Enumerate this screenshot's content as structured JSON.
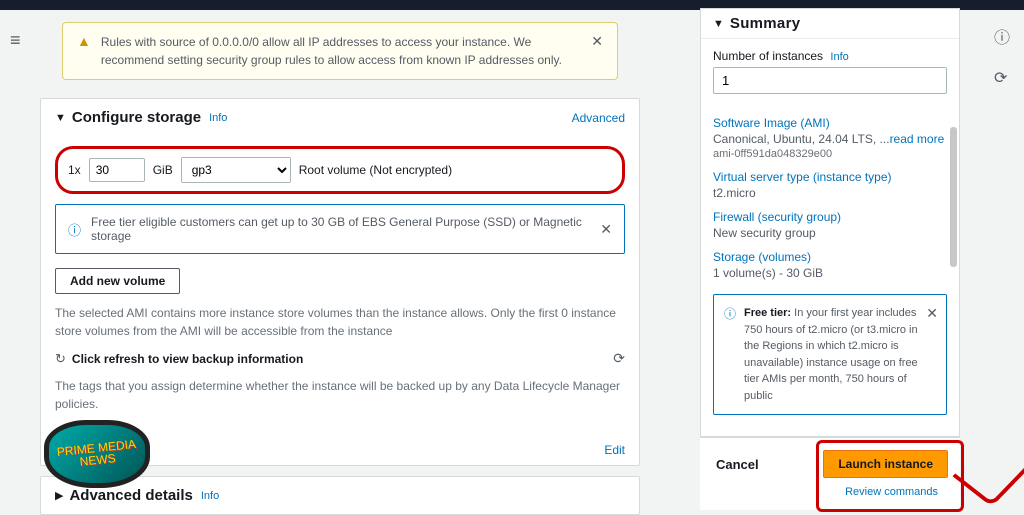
{
  "warning": {
    "text": "Rules with source of 0.0.0.0/0 allow all IP addresses to access your instance. We recommend setting security group rules to allow access from known IP addresses only."
  },
  "storage": {
    "title": "Configure storage",
    "info": "Info",
    "advanced": "Advanced",
    "prefix": "1x",
    "size": "30",
    "unit": "GiB",
    "vol_type": "gp3",
    "root_label": "Root volume  (Not encrypted)",
    "free_tier": "Free tier eligible customers can get up to 30 GB of EBS General Purpose (SSD) or Magnetic storage",
    "add_btn": "Add new volume",
    "note": "The selected AMI contains more instance store volumes than the instance allows. Only the first 0 instance store volumes from the AMI will be accessible from the instance",
    "refresh": "Click refresh to view backup information",
    "refresh_note": "The tags that you assign determine whether the instance will be backed up by any Data Lifecycle Manager policies.",
    "edit": "Edit"
  },
  "advanced_details": {
    "title": "Advanced details",
    "info": "Info"
  },
  "summary": {
    "title": "Summary",
    "num_label": "Number of instances",
    "info": "Info",
    "num_val": "1",
    "ami_label": "Software Image (AMI)",
    "ami_val": "Canonical, Ubuntu, 24.04 LTS, ...",
    "readmore": "read more",
    "ami_id": "ami-0ff591da048329e00",
    "itype_label": "Virtual server type (instance type)",
    "itype_val": "t2.micro",
    "fw_label": "Firewall (security group)",
    "fw_val": "New security group",
    "stor_label": "Storage (volumes)",
    "stor_val": "1 volume(s) - 30 GiB",
    "free_tier": "In your first year includes 750 hours of t2.micro (or t3.micro in the Regions in which t2.micro is unavailable) instance usage on free tier AMIs per month, 750 hours of public"
  },
  "footer": {
    "cancel": "Cancel",
    "launch": "Launch instance",
    "review": "Review commands"
  },
  "logo": "PRIME MEDIA NEWS"
}
